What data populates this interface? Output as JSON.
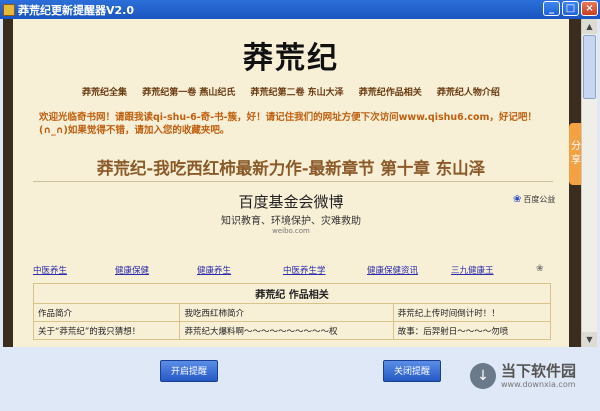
{
  "window": {
    "title": "莽荒纪更新提醒器V2.0",
    "min": "_",
    "max": "□",
    "close": "×"
  },
  "page": {
    "site_title": "莽荒纪",
    "nav": [
      "莽荒纪全集",
      "莽荒纪第一卷 燕山纪氏",
      "莽荒纪第二卷 东山大泽",
      "莽荒纪作品相关",
      "莽荒纪人物介绍"
    ],
    "welcome": "欢迎光临奇书网！请跟我读qi-shu-6-奇-书-簇，好！请记住我们的网址方便下次访问www.qishu6.com，好记吧！(∩_∩)如果觉得不错，请加入您的收藏夹吧。",
    "headline": "莽荒纪-我吃西红柿最新力作-最新章节 第十章 东山泽",
    "ad": {
      "title": "百度基金会微博",
      "subtitle": "知识教育、环境保护、灾难救助",
      "url": "weibo.com",
      "badge": "百度公益"
    },
    "links": [
      "中医养生",
      "健康保健",
      "健康养生",
      "中医养生学",
      "健康保健资讯",
      "三九健康王"
    ],
    "table": {
      "header": "莽荒纪 作品相关",
      "row1": [
        "作品简介",
        "我吃西红柿简介",
        "莽荒纪上传时间倒计时！！"
      ],
      "row2": [
        "关于“莽荒纪”的我只猜想！",
        "莽荒纪大爆料啊～～～～～～～～～～权",
        "故事：后羿射日～～～～勿喷"
      ]
    },
    "share": [
      "分",
      "享"
    ]
  },
  "buttons": {
    "start": "开启提醒",
    "stop": "关闭提醒"
  },
  "watermark": {
    "line1": "当下软件园",
    "line2": "www.downxia.com"
  }
}
